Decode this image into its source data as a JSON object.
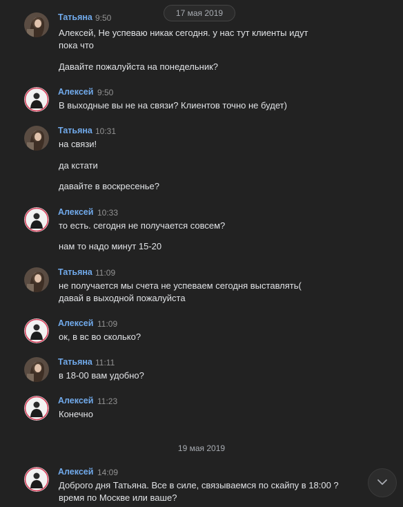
{
  "dates": {
    "first": "17 мая 2019",
    "second": "19 мая 2019"
  },
  "messages": [
    {
      "author": "Татьяна",
      "time": "9:50",
      "lines": [
        "Алексей, Не успеваю никак сегодня. у нас тут клиенты идут",
        "пока что",
        "Давайте пожалуйста на понедельник?"
      ]
    },
    {
      "author": "Алексей",
      "time": "9:50",
      "lines": [
        "В выходные вы не на связи? Клиентов точно не будет)"
      ]
    },
    {
      "author": "Татьяна",
      "time": "10:31",
      "lines": [
        "на связи!",
        "да кстати",
        "давайте в воскресенье?"
      ]
    },
    {
      "author": "Алексей",
      "time": "10:33",
      "lines": [
        "то есть. сегодня не получается совсем?",
        "нам то надо минут 15-20"
      ]
    },
    {
      "author": "Татьяна",
      "time": "11:09",
      "lines": [
        "не получается мы счета не успеваем сегодня выставлять(",
        "давай в выходной пожалуйста"
      ]
    },
    {
      "author": "Алексей",
      "time": "11:09",
      "lines": [
        "ок, в вс во сколько?"
      ]
    },
    {
      "author": "Татьяна",
      "time": "11:11",
      "lines": [
        "в 18-00 вам удобно?"
      ]
    },
    {
      "author": "Алексей",
      "time": "11:23",
      "lines": [
        "Конечно"
      ]
    },
    {
      "author": "Алексей",
      "time": "14:09",
      "lines": [
        "Доброго дня Татьяна. Все в силе, связываемся по скайпу в 18:00 ?",
        "время по Москве или ваше?"
      ]
    }
  ],
  "icons": {
    "scroll_down": "chevron-down-icon",
    "avatar_tatiana": "avatar",
    "avatar_aleksei": "avatar"
  }
}
